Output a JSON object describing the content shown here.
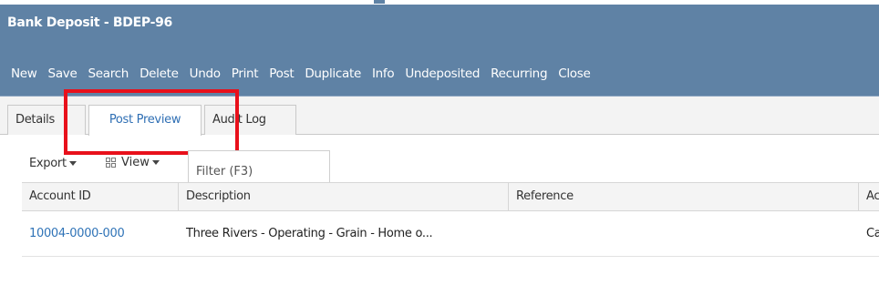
{
  "window": {
    "title": "Bank Deposit - BDEP-96"
  },
  "toolbar": {
    "buttons": [
      "New",
      "Save",
      "Search",
      "Delete",
      "Undo",
      "Print",
      "Post",
      "Duplicate",
      "Info",
      "Undeposited",
      "Recurring",
      "Close"
    ]
  },
  "tabs": [
    {
      "label": "Details"
    },
    {
      "label": "Post Preview"
    },
    {
      "label": "Audit Log"
    }
  ],
  "active_tab": "Post Preview",
  "colors": {
    "header_bg": "#5f82a5",
    "highlight": "#e8101b",
    "link": "#2f73b7"
  },
  "grid_toolbar": {
    "export_label": "Export",
    "view_label": "View",
    "filter_placeholder": "Filter (F3)"
  },
  "grid": {
    "columns": [
      "Account ID",
      "Description",
      "Reference",
      "Acco"
    ],
    "rows": [
      {
        "account_id": "10004-0000-000",
        "description": "Three Rivers - Operating - Grain - Home o...",
        "reference": "",
        "account": "Cash"
      }
    ]
  }
}
